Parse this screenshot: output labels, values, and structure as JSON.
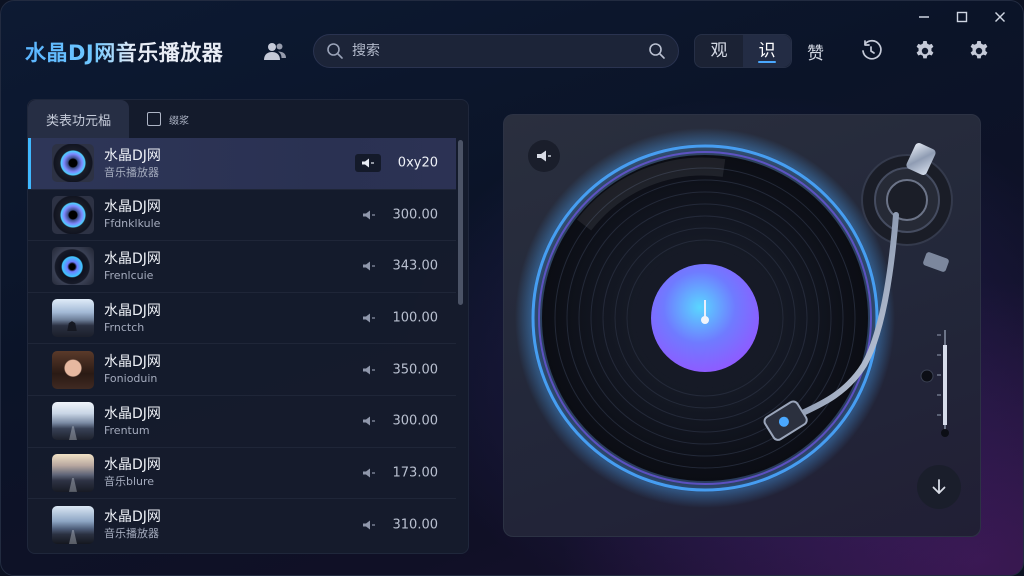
{
  "app": {
    "title": "水晶DJ网音乐播放器"
  },
  "search": {
    "placeholder": "搜索"
  },
  "nav": {
    "tabs": [
      {
        "label": "观"
      },
      {
        "label": "识"
      },
      {
        "label": "赞"
      }
    ],
    "active_index": 1
  },
  "icons": {
    "user": "users-icon",
    "search": "search-icon",
    "timer": "history-icon",
    "settings": "gear-icon",
    "settings2": "gear-icon",
    "volume": "volume-icon",
    "download": "download-icon"
  },
  "panel": {
    "tabs": [
      {
        "label": "类表功元榀"
      },
      {
        "label": "缀浆"
      }
    ]
  },
  "tracks": [
    {
      "title": "水晶DJ网",
      "subtitle": "音乐播放器",
      "time": "0xy20"
    },
    {
      "title": "水晶DJ网",
      "subtitle": "Ffdnklkule",
      "time": "300.00"
    },
    {
      "title": "水晶DJ网",
      "subtitle": "Frenlcuie",
      "time": "343.00"
    },
    {
      "title": "水晶DJ网",
      "subtitle": "Frnctch",
      "time": "100.00"
    },
    {
      "title": "水晶DJ网",
      "subtitle": "Fonioduin",
      "time": "350.00"
    },
    {
      "title": "水晶DJ网",
      "subtitle": "Frentum",
      "time": "300.00"
    },
    {
      "title": "水晶DJ网",
      "subtitle": "音乐blure",
      "time": "173.00"
    },
    {
      "title": "水晶DJ网",
      "subtitle": "音乐播放器",
      "time": "310.00"
    }
  ],
  "colors": {
    "accent": "#3fb8ff",
    "record_label": "#6f7bff",
    "ring": "#4aa8ff"
  }
}
